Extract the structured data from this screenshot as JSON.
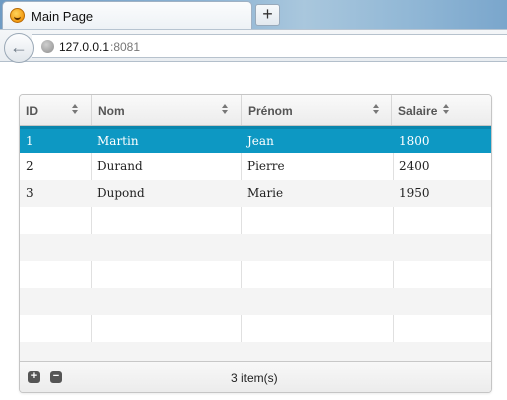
{
  "browser": {
    "tab_title": "Main Page",
    "new_tab_label": "+",
    "url_host": "127.0.0.1",
    "url_port": ":8081"
  },
  "grid": {
    "columns": [
      {
        "label": "ID"
      },
      {
        "label": "Nom"
      },
      {
        "label": "Prénom"
      },
      {
        "label": "Salaire"
      }
    ],
    "rows": [
      {
        "id": "1",
        "nom": "Martin",
        "prenom": "Jean",
        "salaire": "1800",
        "selected": true
      },
      {
        "id": "2",
        "nom": "Durand",
        "prenom": "Pierre",
        "salaire": "2400",
        "selected": false
      },
      {
        "id": "3",
        "nom": "Dupond",
        "prenom": "Marie",
        "salaire": "1950",
        "selected": false
      }
    ],
    "footer": {
      "add_label": "+",
      "remove_label": "−",
      "count_text": "3 item(s)"
    }
  },
  "colors": {
    "selected_row": "#0d98c3",
    "stripe": "#f4f4f4"
  }
}
